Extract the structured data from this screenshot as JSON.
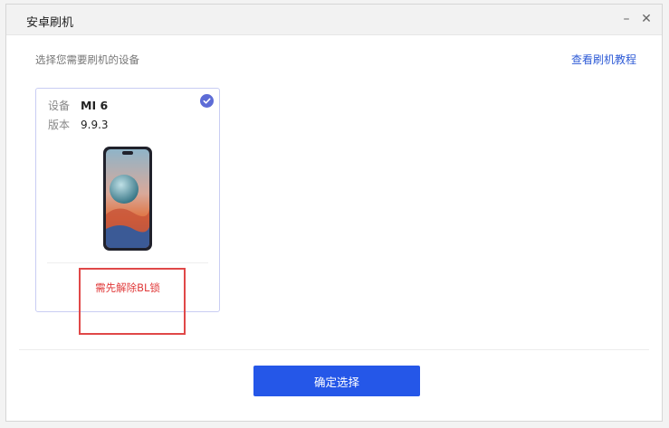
{
  "window": {
    "title": "安卓刷机"
  },
  "header": {
    "prompt": "选择您需要刷机的设备",
    "tutorial_link": "查看刷机教程"
  },
  "device_card": {
    "device_label": "设备",
    "device_value": "MI 6",
    "version_label": "版本",
    "version_value": "9.9.3",
    "warning": "需先解除BL锁",
    "selected": true
  },
  "footer": {
    "confirm_label": "确定选择"
  },
  "colors": {
    "accent": "#2557e8",
    "link": "#2e5bd6",
    "warning": "#e03a3a",
    "check": "#5d6cd6",
    "highlight_box": "#e04848"
  }
}
